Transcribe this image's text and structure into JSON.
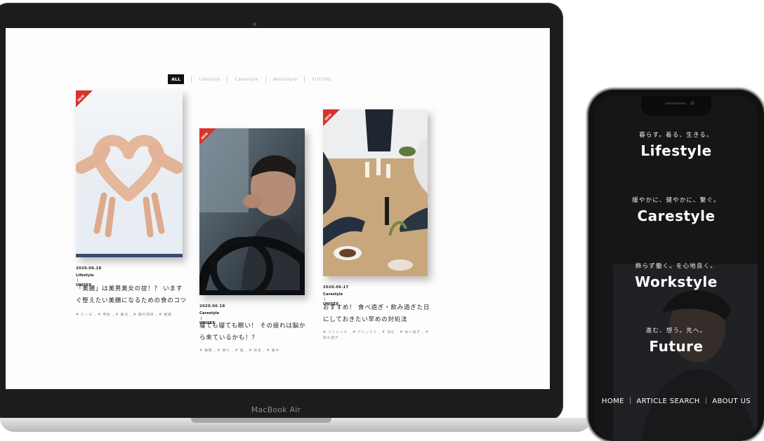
{
  "laptop": {
    "brand": "MacBook Air",
    "filters": [
      "ALL",
      "Lifestyle",
      "Carestyle",
      "Workstyle",
      "FUTURE"
    ],
    "articles": [
      {
        "badge": "NEW",
        "date": "2020.06.18",
        "category": "Lifestyle ｜ UNISEX",
        "title_lines": [
          "「美腸」は美男美女の掟！？ います",
          "ぐ整えたい美腸になるための食のコツ"
        ],
        "tags": "# むくみ , # 便秘 , # 腸活 , # 腸内環境 , # 健康 ,"
      },
      {
        "badge": "NEW",
        "date": "2020.06.18",
        "category": "Carestyle ｜ UNISEX",
        "title_lines": [
          "寝ても寝ても眠い！ その疲れは脳か",
          "ら来ているかも！？"
        ],
        "tags": "# 睡眠 , # 疲れ , # 脳 , # 休息 , # 集中 ,"
      },
      {
        "badge": "NEW",
        "date": "2020.06.17",
        "category": "Carestyle ｜ UNISEX",
        "title_lines": [
          "おすすめ！ 食べ過ぎ・飲み過ぎた日",
          "にしておきたい早めの対処法"
        ],
        "tags_lines": [
          "# ストレッチ , # デトックス , # 消化 , # 食べ過ぎ , #",
          "飲み過ぎ ,"
        ]
      }
    ]
  },
  "phone": {
    "menu": [
      {
        "sub": "暮らす。着る、生きる。",
        "title": "Lifestyle"
      },
      {
        "sub": "緩やかに、健やかに、繋ぐ。",
        "title": "Carestyle"
      },
      {
        "sub": "飾らず働く。を心地良く。",
        "title": "Workstyle"
      },
      {
        "sub": "進む、想う。先へ。",
        "title": "Future"
      }
    ],
    "footer": "HOME ｜ ARTICLE SEARCH ｜ ABOUT US"
  },
  "colors": {
    "badge": "#d8342c",
    "laptop_frame": "#1c1c1e",
    "phone_bg": "#161616"
  }
}
